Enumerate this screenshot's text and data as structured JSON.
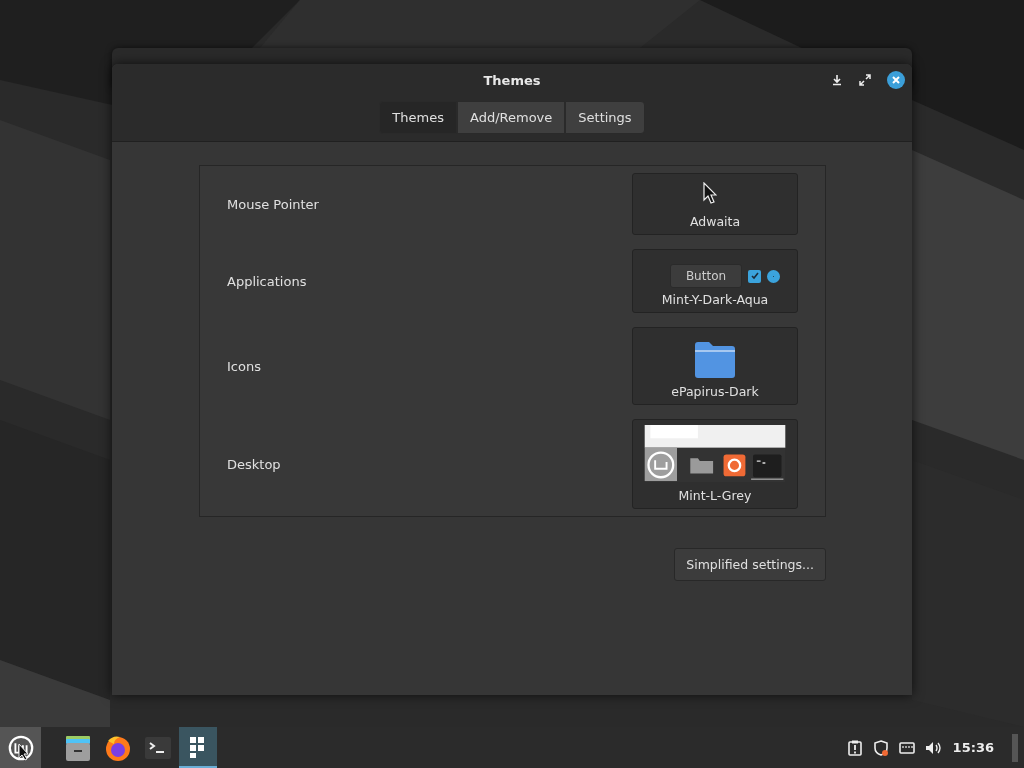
{
  "window": {
    "title": "Themes"
  },
  "tabs": [
    {
      "label": "Themes",
      "selected": true
    },
    {
      "label": "Add/Remove",
      "selected": false
    },
    {
      "label": "Settings",
      "selected": false
    }
  ],
  "rows": [
    {
      "label": "Mouse Pointer",
      "kind": "cursor",
      "theme": "Adwaita"
    },
    {
      "label": "Applications",
      "kind": "widgets",
      "theme": "Mint-Y-Dark-Aqua",
      "button": "Button",
      "checked": true,
      "radio_selected": true
    },
    {
      "label": "Icons",
      "kind": "folder",
      "theme": "ePapirus-Dark"
    },
    {
      "label": "Desktop",
      "kind": "desktop",
      "theme": "Mint-L-Grey"
    }
  ],
  "simplified_button": "Simplified settings...",
  "taskbar": {
    "launchers": [
      {
        "kind": "files",
        "active": false
      },
      {
        "kind": "browser",
        "active": false
      },
      {
        "kind": "terminal",
        "active": false
      },
      {
        "kind": "grid",
        "active": true
      }
    ],
    "clock": "15:36"
  }
}
